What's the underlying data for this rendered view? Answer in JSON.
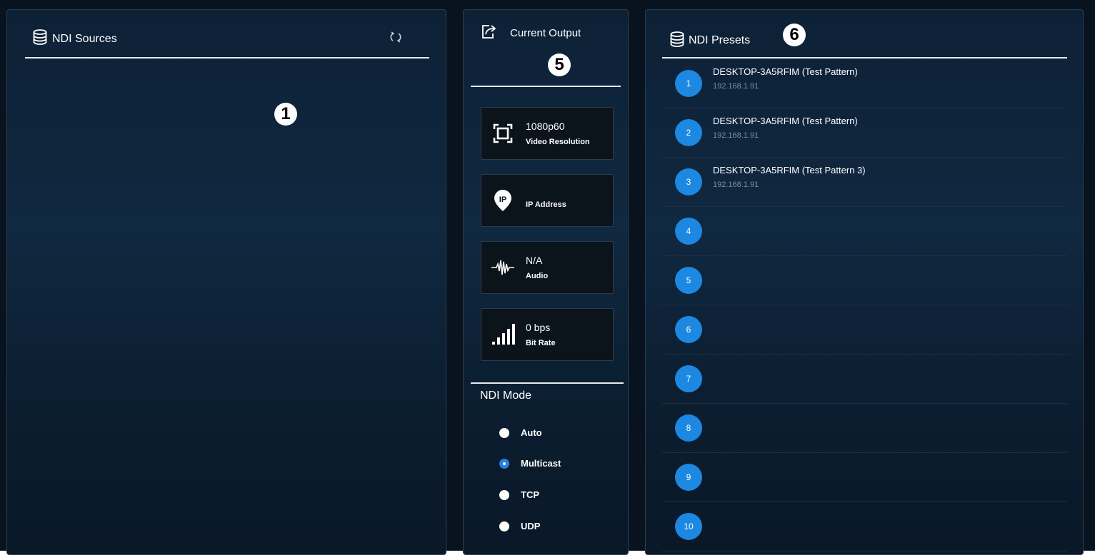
{
  "sources": {
    "title": "NDI Sources",
    "icon": "database-icon",
    "refresh_icon": "refresh-icon",
    "callout": "1"
  },
  "output": {
    "title": "Current Output",
    "icon": "output-share-icon",
    "callout": "5",
    "cards": [
      {
        "value": "1080p60",
        "label": "Video Resolution",
        "icon": "resolution-frame-icon"
      },
      {
        "value": "",
        "label": "IP Address",
        "icon": "ip-location-pin-icon"
      },
      {
        "value": "N/A",
        "label": "Audio",
        "icon": "audio-waveform-icon"
      },
      {
        "value": "0 bps",
        "label": "Bit Rate",
        "icon": "signal-bars-icon"
      }
    ],
    "mode_title": "NDI Mode",
    "modes": [
      {
        "label": "Auto",
        "selected": false
      },
      {
        "label": "Multicast",
        "selected": true
      },
      {
        "label": "TCP",
        "selected": false
      },
      {
        "label": "UDP",
        "selected": false
      }
    ]
  },
  "presets": {
    "title": "NDI Presets",
    "icon": "database-icon",
    "callout": "6",
    "items": [
      {
        "num": "1",
        "name": "DESKTOP-3A5RFIM (Test Pattern)",
        "ip": "192.168.1.91"
      },
      {
        "num": "2",
        "name": "DESKTOP-3A5RFIM (Test Pattern)",
        "ip": "192.168.1.91"
      },
      {
        "num": "3",
        "name": "DESKTOP-3A5RFIM (Test Pattern 3)",
        "ip": "192.168.1.91"
      },
      {
        "num": "4",
        "name": "",
        "ip": ""
      },
      {
        "num": "5",
        "name": "",
        "ip": ""
      },
      {
        "num": "6",
        "name": "",
        "ip": ""
      },
      {
        "num": "7",
        "name": "",
        "ip": ""
      },
      {
        "num": "8",
        "name": "",
        "ip": ""
      },
      {
        "num": "9",
        "name": "",
        "ip": ""
      },
      {
        "num": "10",
        "name": "",
        "ip": ""
      }
    ]
  },
  "colors": {
    "accent": "#1d88e2",
    "radio_selected": "#2b7de0",
    "background": "#0d2136"
  }
}
